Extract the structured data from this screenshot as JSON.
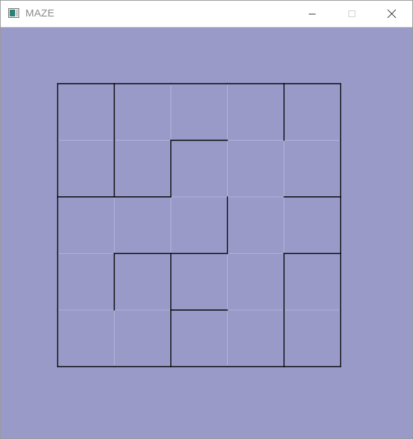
{
  "window": {
    "title": "MAZE",
    "icon": "app-window-icon",
    "controls": [
      "minimize-icon",
      "maximize-icon",
      "close-icon"
    ]
  },
  "colors": {
    "background": "#999ac8",
    "grid_line": "#b3b4dc",
    "wall": "#000000",
    "titlebar": "#ffffff"
  },
  "maze": {
    "rows": 5,
    "cols": 5,
    "h_walls": [
      [
        0,
        0
      ],
      [
        0,
        1
      ],
      [
        0,
        2
      ],
      [
        0,
        3
      ],
      [
        0,
        4
      ],
      [
        1,
        2
      ],
      [
        2,
        0
      ],
      [
        2,
        1
      ],
      [
        2,
        4
      ],
      [
        3,
        1
      ],
      [
        3,
        2
      ],
      [
        3,
        4
      ],
      [
        4,
        2
      ],
      [
        5,
        0
      ],
      [
        5,
        1
      ],
      [
        5,
        2
      ],
      [
        5,
        3
      ],
      [
        5,
        4
      ]
    ],
    "v_walls": [
      [
        0,
        0
      ],
      [
        1,
        0
      ],
      [
        2,
        0
      ],
      [
        3,
        0
      ],
      [
        4,
        0
      ],
      [
        0,
        1
      ],
      [
        1,
        1
      ],
      [
        3,
        1
      ],
      [
        1,
        2
      ],
      [
        3,
        2
      ],
      [
        4,
        2
      ],
      [
        2,
        3
      ],
      [
        0,
        4
      ],
      [
        3,
        4
      ],
      [
        4,
        4
      ],
      [
        0,
        5
      ],
      [
        1,
        5
      ],
      [
        2,
        5
      ],
      [
        3,
        5
      ],
      [
        4,
        5
      ]
    ]
  }
}
